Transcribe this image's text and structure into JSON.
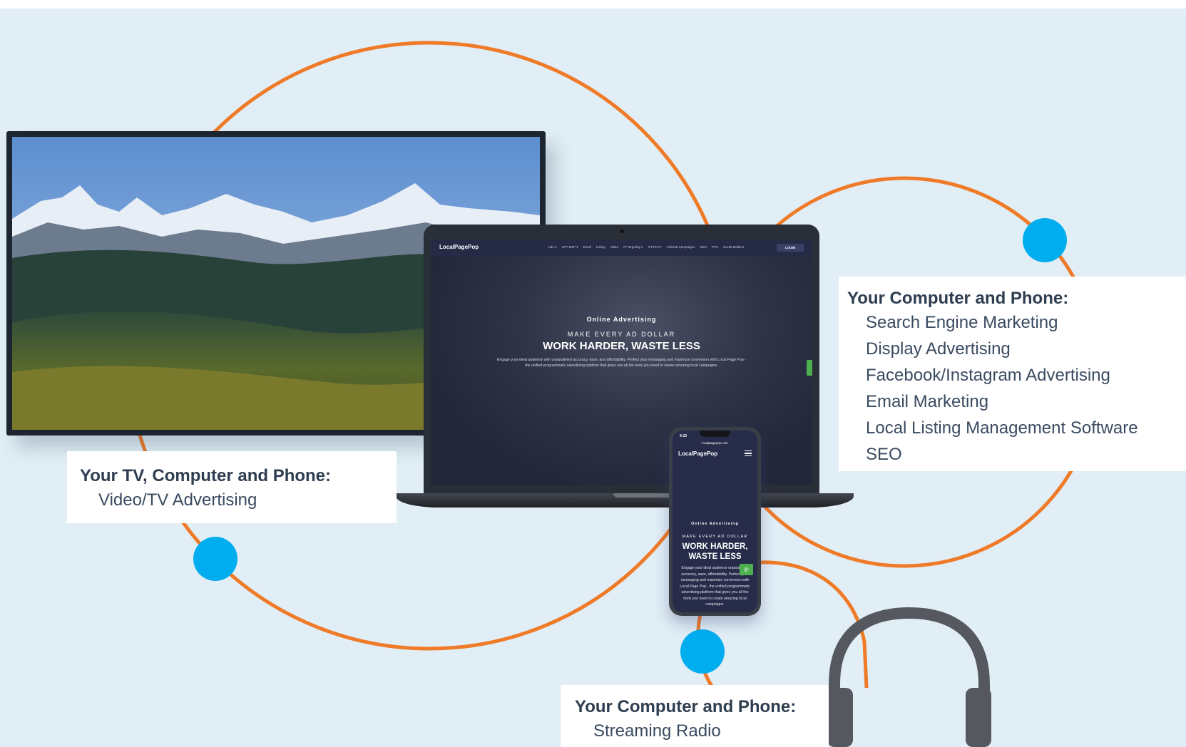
{
  "colors": {
    "background": "#e1eef6",
    "orbit_line": "#ef7a27",
    "dot": "#00aeef",
    "box_text": "#2e3d50",
    "headphones": "#55595f"
  },
  "tv_box": {
    "heading": "Your TV, Computer and Phone:",
    "items": [
      "Video/TV Advertising"
    ]
  },
  "computer_box": {
    "heading": "Your Computer and Phone:",
    "items": [
      "Search Engine Marketing",
      "Display Advertising",
      "Facebook/Instagram Advertising",
      "Email Marketing",
      "Local Listing Management Software",
      "SEO"
    ]
  },
  "radio_box": {
    "heading": "Your Computer and Phone:",
    "items": [
      "Streaming Radio"
    ]
  },
  "laptop_site": {
    "logo": "LocalPagePop",
    "nav": [
      "LBA ▾",
      "LPP-DSP ▾",
      "Email",
      "Listing",
      "Video",
      "IP Targeting ▾",
      "OTT/CTV",
      "Political Campaigns",
      "SEO",
      "PPC",
      "Social Media ▾"
    ],
    "login": "LOGIN",
    "kicker": "Online Advertising",
    "eyebrow": "MAKE EVERY AD DOLLAR",
    "headline": "WORK HARDER, WASTE LESS",
    "body": "Engage your ideal audience with unparalleled accuracy, ease, and affordability. Perfect your messaging and maximize conversion with Local Page Pop - the unified programmatic advertising platform that gives you all the tools you need to create amazing local campaigns."
  },
  "phone_site": {
    "status_time": "9:19",
    "url": "localpagepop.com",
    "logo": "LocalPagePop",
    "kicker": "Online Advertising",
    "eyebrow": "MAKE EVERY AD DOLLAR",
    "headline": "WORK HARDER, WASTE LESS",
    "body": "Engage your ideal audience unparalleled accuracy, ease, affordability. Perfect your messaging and maximize conversion with Local Page Pop - the unified programmatic advertising platform that gives you all the tools you need to create amazing local campaigns."
  },
  "icons": [
    "headphones-icon",
    "phone-call-icon",
    "hamburger-menu-icon"
  ]
}
